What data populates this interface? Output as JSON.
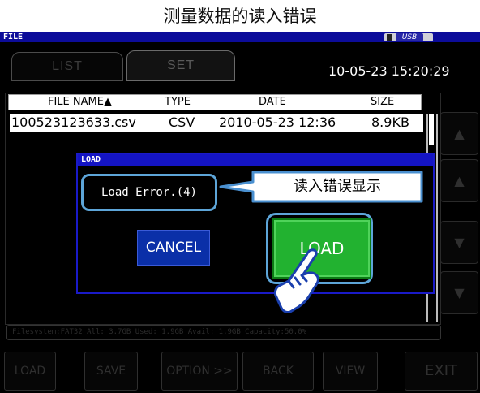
{
  "caption": "测量数据的读入错误",
  "window": {
    "title": "FILE",
    "usb_label": "USB"
  },
  "tabs": {
    "list": "LIST",
    "set": "SET"
  },
  "clock": "10-05-23 15:20:29",
  "file_table": {
    "headers": {
      "name": "FILE NAME▲",
      "type": "TYPE",
      "date": "DATE",
      "size": "SIZE"
    },
    "rows": [
      {
        "name": "100523123633.csv",
        "type": "CSV",
        "date": "2010-05-23 12:36",
        "size": "8.9KB"
      }
    ]
  },
  "status_bar": "Filesystem:FAT32 All: 3.7GB Used: 1.9GB Avail: 1.9GB Capacity:50.0%",
  "dialog": {
    "title": "LOAD",
    "error_message": "Load Error.(4)",
    "callout": "读入错误显示",
    "cancel_label": "CANCEL",
    "load_label": "LOAD"
  },
  "bottom_buttons": {
    "load": "LOAD",
    "save": "SAVE",
    "option": "OPTION >>",
    "back": "BACK",
    "view": "VIEW",
    "exit": "EXIT"
  },
  "icons": {
    "scroll_top": "double-up-arrow-icon",
    "scroll_up": "up-arrow-icon",
    "scroll_down": "down-arrow-icon",
    "scroll_bottom": "double-down-arrow-icon",
    "pointer": "pointing-hand-icon"
  },
  "colors": {
    "titlebar": "#0c0c9a",
    "dialog_title": "#1414c4",
    "cancel_button": "#0a2fa8",
    "load_button": "#22b230",
    "highlight_ring": "#5da5d8"
  }
}
